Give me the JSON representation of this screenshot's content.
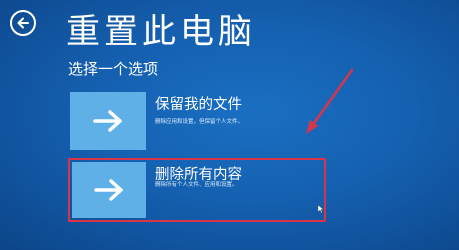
{
  "header": {
    "back_icon": "back-arrow-icon",
    "title": "重置此电脑"
  },
  "main": {
    "subtitle": "选择一个选项",
    "options": [
      {
        "icon": "right-arrow-icon",
        "title": "保留我的文件",
        "description": "删除应用和设置，但保留个人文件。"
      },
      {
        "icon": "right-arrow-icon",
        "title": "删除所有内容",
        "description": "删除所有个人文件、应用和设置。"
      }
    ]
  },
  "annotation": {
    "highlight_color": "#d8354a",
    "arrow_color": "#d8354a"
  },
  "colors": {
    "background": "#1560b0",
    "tile": "#5fb0e6",
    "text": "#ffffff"
  }
}
